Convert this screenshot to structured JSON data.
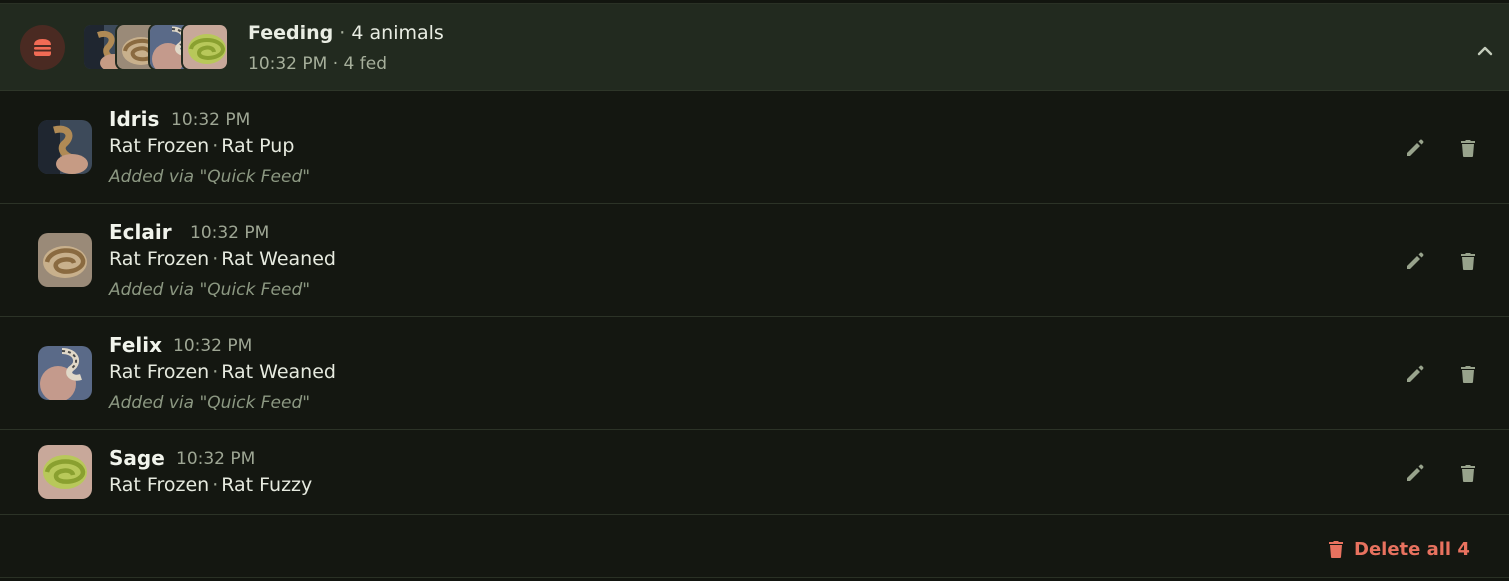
{
  "colors": {
    "header_bg": "#222a1f",
    "body_bg": "#141711",
    "accent_danger": "#e8725f",
    "icon_muted": "#98a38c"
  },
  "group": {
    "type_icon": "burger-icon",
    "title": "Feeding",
    "separator": "·",
    "count_label": "4 animals",
    "subtitle": "10:32 PM · 4 fed",
    "collapse_icon": "chevron-up-icon",
    "stack_avatars": [
      "Idris",
      "Eclair",
      "Felix",
      "Sage"
    ]
  },
  "entries": [
    {
      "name": "Idris",
      "time": "10:32 PM",
      "prey": "Rat Frozen",
      "sep": "·",
      "size": "Rat Pup",
      "note": "Added via \"Quick Feed\""
    },
    {
      "name": "Eclair",
      "time": "10:32 PM",
      "prey": "Rat Frozen",
      "sep": "·",
      "size": "Rat Weaned",
      "note": "Added via \"Quick Feed\""
    },
    {
      "name": "Felix",
      "time": "10:32 PM",
      "prey": "Rat Frozen",
      "sep": "·",
      "size": "Rat Weaned",
      "note": "Added via \"Quick Feed\""
    },
    {
      "name": "Sage",
      "time": "10:32 PM",
      "prey": "Rat Frozen",
      "sep": "·",
      "size": "Rat Fuzzy",
      "note": ""
    }
  ],
  "footer": {
    "delete_all_label": "Delete all 4",
    "delete_icon": "trash-icon"
  }
}
